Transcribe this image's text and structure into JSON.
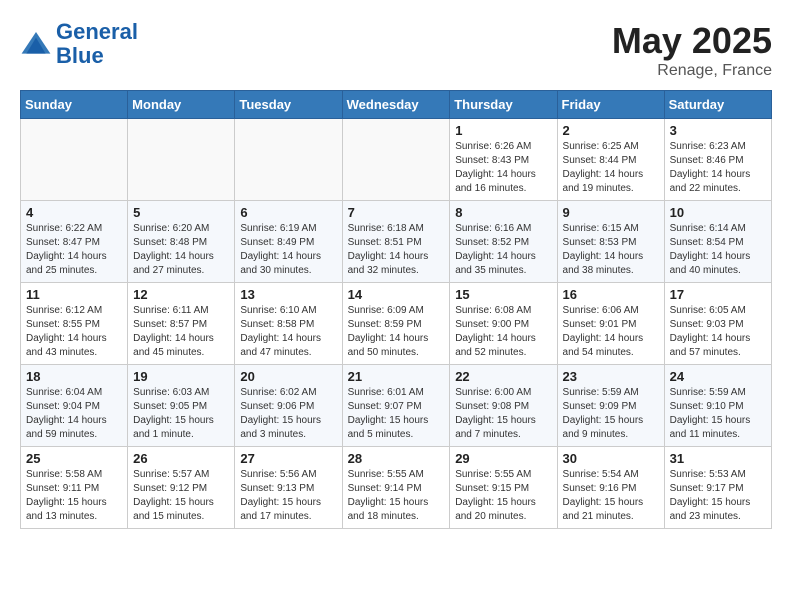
{
  "header": {
    "logo_line1": "General",
    "logo_line2": "Blue",
    "month": "May 2025",
    "location": "Renage, France"
  },
  "weekdays": [
    "Sunday",
    "Monday",
    "Tuesday",
    "Wednesday",
    "Thursday",
    "Friday",
    "Saturday"
  ],
  "weeks": [
    [
      {
        "day": "",
        "info": ""
      },
      {
        "day": "",
        "info": ""
      },
      {
        "day": "",
        "info": ""
      },
      {
        "day": "",
        "info": ""
      },
      {
        "day": "1",
        "info": "Sunrise: 6:26 AM\nSunset: 8:43 PM\nDaylight: 14 hours\nand 16 minutes."
      },
      {
        "day": "2",
        "info": "Sunrise: 6:25 AM\nSunset: 8:44 PM\nDaylight: 14 hours\nand 19 minutes."
      },
      {
        "day": "3",
        "info": "Sunrise: 6:23 AM\nSunset: 8:46 PM\nDaylight: 14 hours\nand 22 minutes."
      }
    ],
    [
      {
        "day": "4",
        "info": "Sunrise: 6:22 AM\nSunset: 8:47 PM\nDaylight: 14 hours\nand 25 minutes."
      },
      {
        "day": "5",
        "info": "Sunrise: 6:20 AM\nSunset: 8:48 PM\nDaylight: 14 hours\nand 27 minutes."
      },
      {
        "day": "6",
        "info": "Sunrise: 6:19 AM\nSunset: 8:49 PM\nDaylight: 14 hours\nand 30 minutes."
      },
      {
        "day": "7",
        "info": "Sunrise: 6:18 AM\nSunset: 8:51 PM\nDaylight: 14 hours\nand 32 minutes."
      },
      {
        "day": "8",
        "info": "Sunrise: 6:16 AM\nSunset: 8:52 PM\nDaylight: 14 hours\nand 35 minutes."
      },
      {
        "day": "9",
        "info": "Sunrise: 6:15 AM\nSunset: 8:53 PM\nDaylight: 14 hours\nand 38 minutes."
      },
      {
        "day": "10",
        "info": "Sunrise: 6:14 AM\nSunset: 8:54 PM\nDaylight: 14 hours\nand 40 minutes."
      }
    ],
    [
      {
        "day": "11",
        "info": "Sunrise: 6:12 AM\nSunset: 8:55 PM\nDaylight: 14 hours\nand 43 minutes."
      },
      {
        "day": "12",
        "info": "Sunrise: 6:11 AM\nSunset: 8:57 PM\nDaylight: 14 hours\nand 45 minutes."
      },
      {
        "day": "13",
        "info": "Sunrise: 6:10 AM\nSunset: 8:58 PM\nDaylight: 14 hours\nand 47 minutes."
      },
      {
        "day": "14",
        "info": "Sunrise: 6:09 AM\nSunset: 8:59 PM\nDaylight: 14 hours\nand 50 minutes."
      },
      {
        "day": "15",
        "info": "Sunrise: 6:08 AM\nSunset: 9:00 PM\nDaylight: 14 hours\nand 52 minutes."
      },
      {
        "day": "16",
        "info": "Sunrise: 6:06 AM\nSunset: 9:01 PM\nDaylight: 14 hours\nand 54 minutes."
      },
      {
        "day": "17",
        "info": "Sunrise: 6:05 AM\nSunset: 9:03 PM\nDaylight: 14 hours\nand 57 minutes."
      }
    ],
    [
      {
        "day": "18",
        "info": "Sunrise: 6:04 AM\nSunset: 9:04 PM\nDaylight: 14 hours\nand 59 minutes."
      },
      {
        "day": "19",
        "info": "Sunrise: 6:03 AM\nSunset: 9:05 PM\nDaylight: 15 hours\nand 1 minute."
      },
      {
        "day": "20",
        "info": "Sunrise: 6:02 AM\nSunset: 9:06 PM\nDaylight: 15 hours\nand 3 minutes."
      },
      {
        "day": "21",
        "info": "Sunrise: 6:01 AM\nSunset: 9:07 PM\nDaylight: 15 hours\nand 5 minutes."
      },
      {
        "day": "22",
        "info": "Sunrise: 6:00 AM\nSunset: 9:08 PM\nDaylight: 15 hours\nand 7 minutes."
      },
      {
        "day": "23",
        "info": "Sunrise: 5:59 AM\nSunset: 9:09 PM\nDaylight: 15 hours\nand 9 minutes."
      },
      {
        "day": "24",
        "info": "Sunrise: 5:59 AM\nSunset: 9:10 PM\nDaylight: 15 hours\nand 11 minutes."
      }
    ],
    [
      {
        "day": "25",
        "info": "Sunrise: 5:58 AM\nSunset: 9:11 PM\nDaylight: 15 hours\nand 13 minutes."
      },
      {
        "day": "26",
        "info": "Sunrise: 5:57 AM\nSunset: 9:12 PM\nDaylight: 15 hours\nand 15 minutes."
      },
      {
        "day": "27",
        "info": "Sunrise: 5:56 AM\nSunset: 9:13 PM\nDaylight: 15 hours\nand 17 minutes."
      },
      {
        "day": "28",
        "info": "Sunrise: 5:55 AM\nSunset: 9:14 PM\nDaylight: 15 hours\nand 18 minutes."
      },
      {
        "day": "29",
        "info": "Sunrise: 5:55 AM\nSunset: 9:15 PM\nDaylight: 15 hours\nand 20 minutes."
      },
      {
        "day": "30",
        "info": "Sunrise: 5:54 AM\nSunset: 9:16 PM\nDaylight: 15 hours\nand 21 minutes."
      },
      {
        "day": "31",
        "info": "Sunrise: 5:53 AM\nSunset: 9:17 PM\nDaylight: 15 hours\nand 23 minutes."
      }
    ]
  ]
}
